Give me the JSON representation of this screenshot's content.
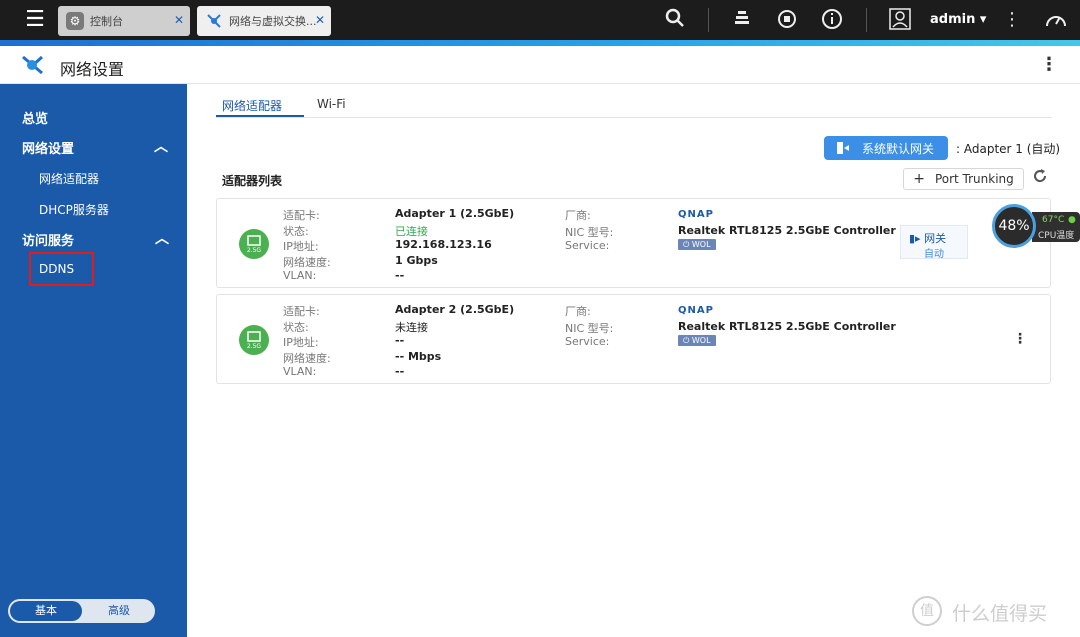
{
  "topbar": {
    "tabs": [
      {
        "label": "控制台",
        "icon": "gear-icon"
      },
      {
        "label": "网络与虚拟交换...",
        "icon": "network-icon"
      }
    ],
    "user": "admin"
  },
  "header": {
    "title": "网络设置"
  },
  "sidebar": {
    "items": [
      {
        "label": "总览"
      },
      {
        "label": "网络设置"
      },
      {
        "label": "网络适配器"
      },
      {
        "label": "DHCP服务器"
      },
      {
        "label": "访问服务"
      },
      {
        "label": "DDNS"
      }
    ],
    "mode": {
      "basic": "基本",
      "advanced": "高级"
    }
  },
  "content": {
    "tabs": [
      {
        "label": "网络适配器"
      },
      {
        "label": "Wi-Fi"
      }
    ],
    "gateway_button": "系统默认网关",
    "gateway_value": ": Adapter 1 (自动)",
    "list_title": "适配器列表",
    "trunk_button": "Port Trunking"
  },
  "labels": {
    "adapter": "适配卡:",
    "status": "状态:",
    "ip": "IP地址:",
    "speed": "网络速度:",
    "vlan": "VLAN:",
    "vendor": "厂商:",
    "nic": "NIC 型号:",
    "service": "Service:"
  },
  "adapters": [
    {
      "badge": "2.5G",
      "name": "Adapter 1 (2.5GbE)",
      "status": "已连接",
      "ip": "192.168.123.16",
      "speed": "1 Gbps",
      "vlan": "--",
      "vendor": "QNAP",
      "nic": "Realtek RTL8125 2.5GbE Controller",
      "wol": "WOL",
      "gateway_tag": "网关",
      "gateway_mode": "自动"
    },
    {
      "badge": "2.5G",
      "name": "Adapter 2 (2.5GbE)",
      "status": "未连接",
      "ip": "--",
      "speed": "-- Mbps",
      "vlan": "--",
      "vendor": "QNAP",
      "nic": "Realtek RTL8125 2.5GbE Controller",
      "wol": "WOL"
    }
  ],
  "cpu_widget": {
    "usage": "48%",
    "temp": "67°C",
    "label": "CPU温度"
  },
  "watermark": "什么值得买",
  "watermark_icon": "值"
}
